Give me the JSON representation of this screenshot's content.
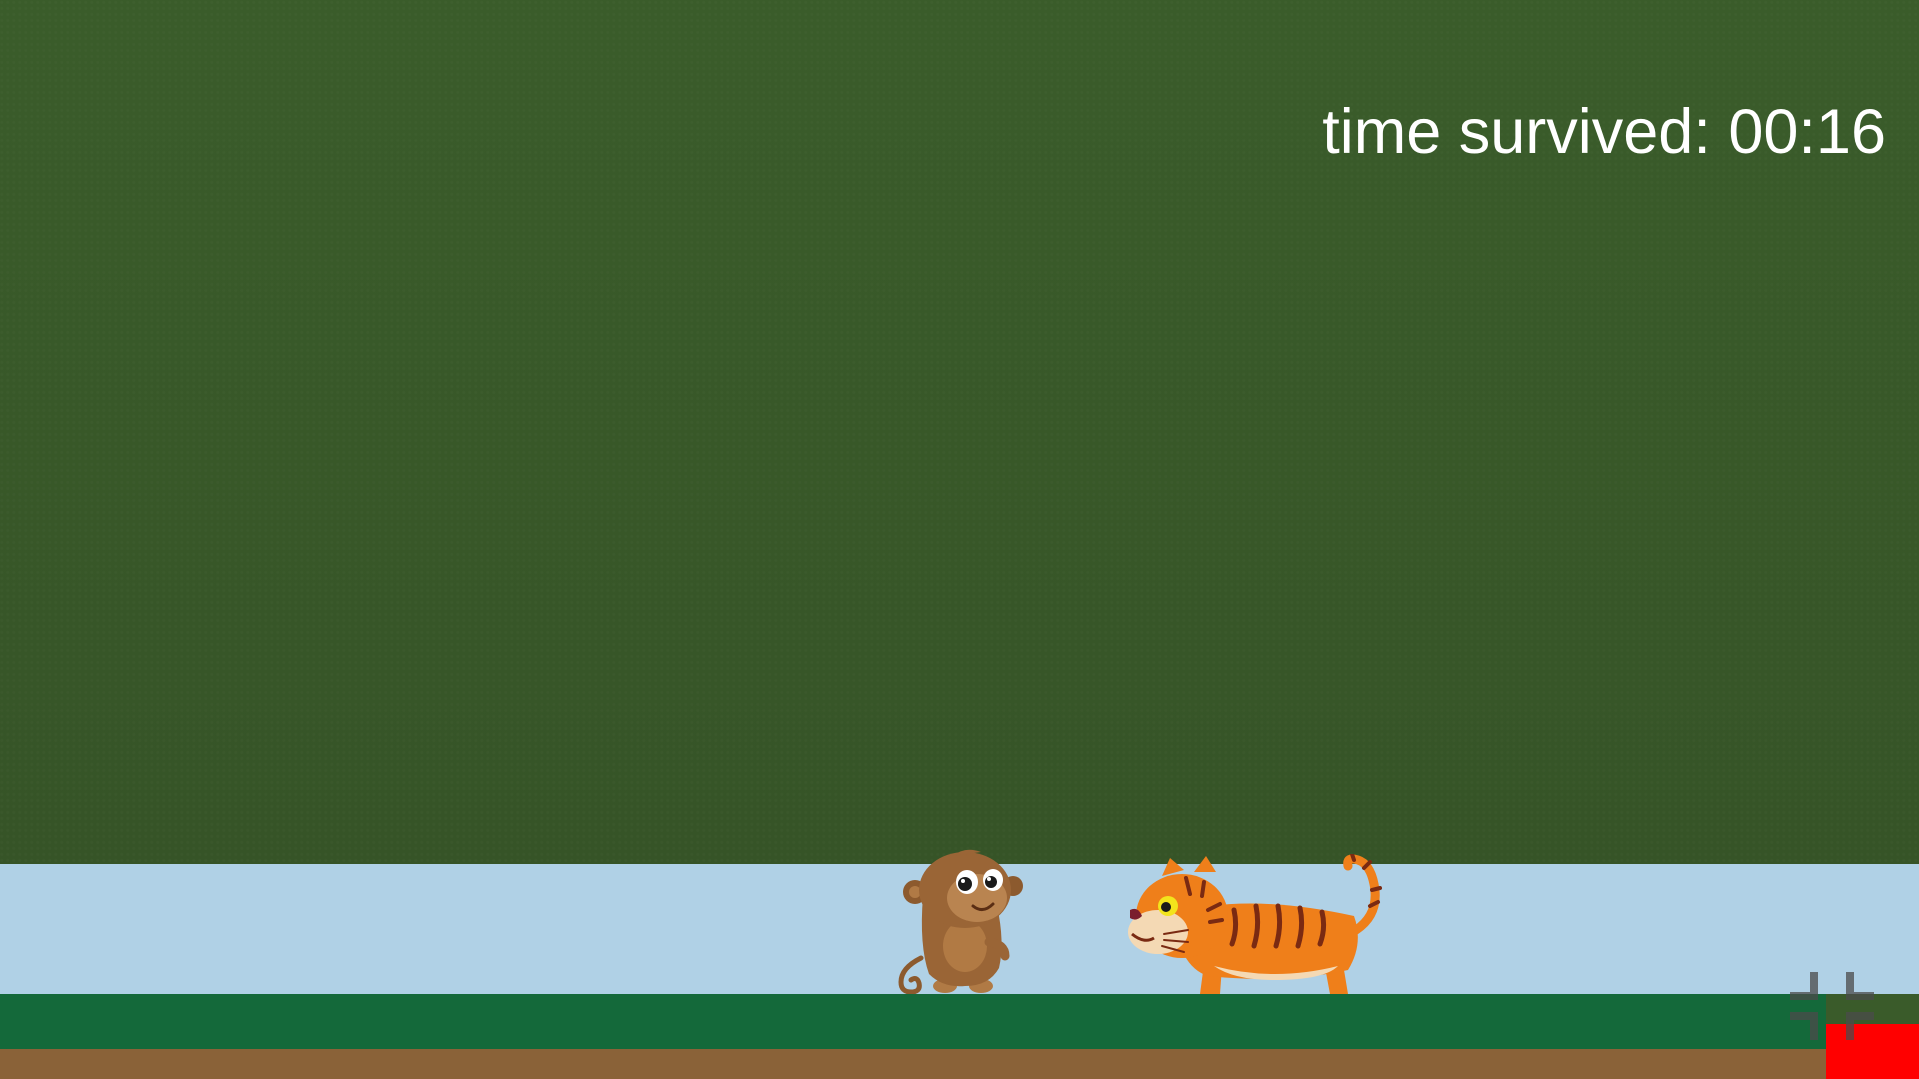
{
  "hud": {
    "timer_text": "time survived: 00:16"
  },
  "sprites": {
    "player": "monkey",
    "enemy": "tiger"
  },
  "controls": {
    "fullscreen_icon": "exit-fullscreen-icon"
  },
  "colors": {
    "jungle_background": "#3a5b2a",
    "water": "#b0d1e6",
    "grass": "#14693a",
    "dirt": "#8a6238",
    "red_block": "#ff0000",
    "timer_text": "#ffffff"
  }
}
